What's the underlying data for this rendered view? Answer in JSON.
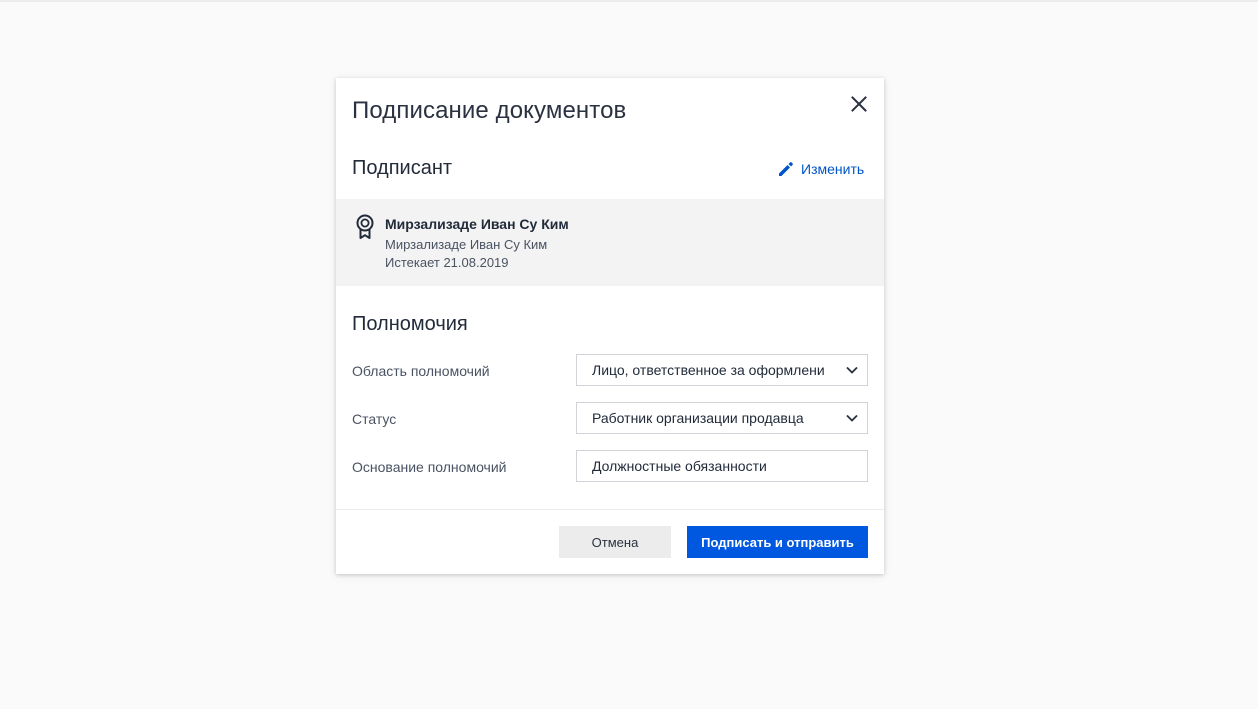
{
  "dialog": {
    "title": "Подписание документов"
  },
  "signer": {
    "section_title": "Подписант",
    "edit_label": "Изменить",
    "name": "Мирзализаде Иван Су Ким",
    "sub_name": "Мирзализаде Иван Су Ким",
    "expires": "Истекает 21.08.2019"
  },
  "powers": {
    "section_title": "Полномочия",
    "scope_label": "Область полномочий",
    "scope_value": "Лицо, ответственное за оформлени",
    "status_label": "Статус",
    "status_value": "Работник организации продавца",
    "basis_label": "Основание полномочий",
    "basis_value": "Должностные обязанности"
  },
  "footer": {
    "cancel_label": "Отмена",
    "sign_label": "Подписать и отправить"
  },
  "icons": {
    "close": "close-icon",
    "edit": "pencil-icon",
    "certificate": "certificate-icon",
    "dropdown": "chevron-down-icon"
  },
  "colors": {
    "accent": "#0057e0",
    "link": "#0055c8",
    "card_bg": "#f3f3f3"
  }
}
